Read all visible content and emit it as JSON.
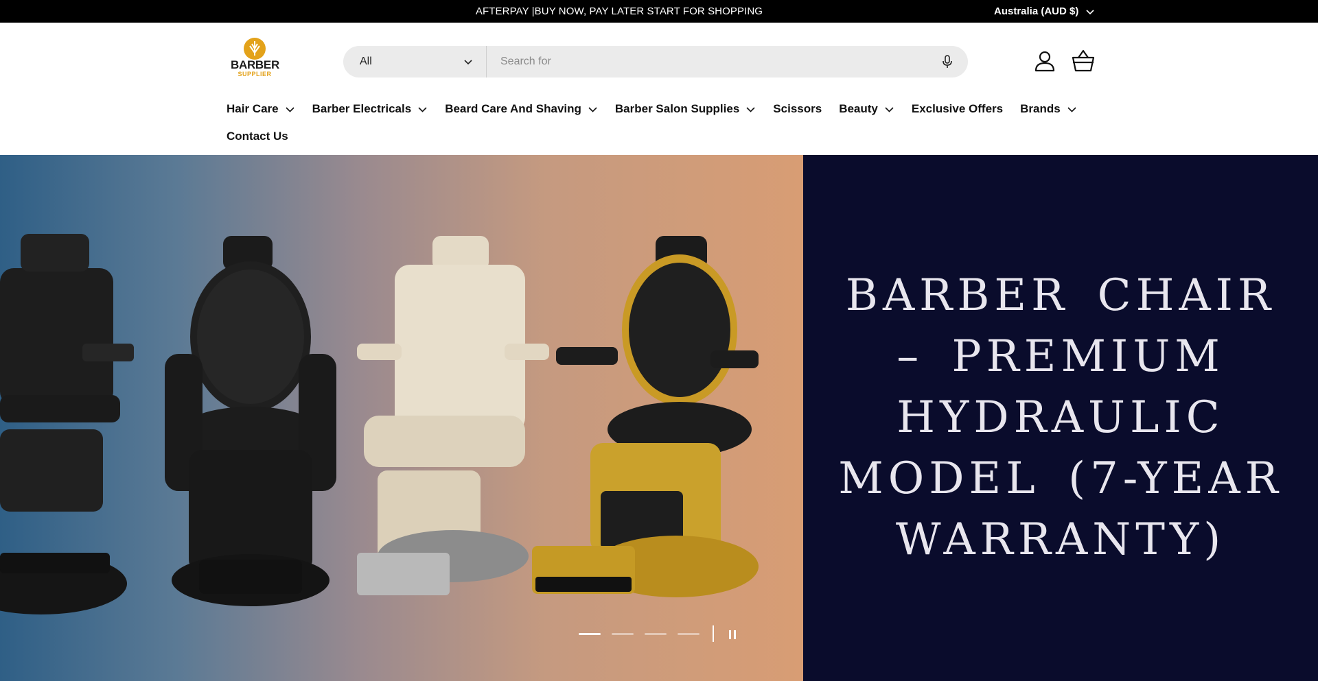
{
  "announcement": {
    "text": "AFTERPAY |BUY NOW, PAY LATER START FOR SHOPPING",
    "currency": "Australia (AUD $)"
  },
  "logo": {
    "title": "BARBER",
    "subtitle": "SUPPLIER",
    "accent_color": "#e3a21a"
  },
  "search": {
    "category": "All",
    "placeholder": "Search for",
    "value": ""
  },
  "header_icons": {
    "account": "user-icon",
    "cart": "basket-icon"
  },
  "nav": {
    "row1": [
      {
        "label": "Hair Care",
        "has_dropdown": true
      },
      {
        "label": "Barber Electricals",
        "has_dropdown": true
      },
      {
        "label": "Beard Care And Shaving",
        "has_dropdown": true
      },
      {
        "label": "Barber Salon Supplies",
        "has_dropdown": true
      },
      {
        "label": "Scissors",
        "has_dropdown": false
      },
      {
        "label": "Beauty",
        "has_dropdown": true
      },
      {
        "label": "Exclusive Offers",
        "has_dropdown": false
      },
      {
        "label": "Brands",
        "has_dropdown": true
      }
    ],
    "row2": [
      {
        "label": "Contact Us",
        "has_dropdown": false
      }
    ]
  },
  "hero": {
    "title": "BARBER CHAIR – PREMIUM HYDRAULIC MODEL (7-YEAR WARRANTY)",
    "panel_color": "#0a0c2c",
    "slides_total": 4,
    "active_slide": 1
  }
}
